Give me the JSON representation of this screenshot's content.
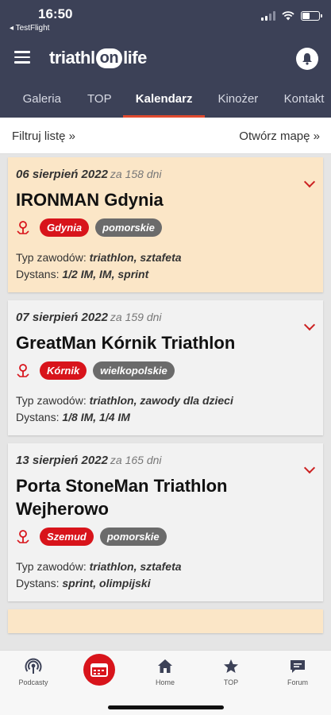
{
  "status": {
    "time": "16:50",
    "back_label": "◂ TestFlight"
  },
  "header": {
    "logo_left": "triathl",
    "logo_on": "on",
    "logo_right": "life"
  },
  "tabs": [
    {
      "label": "Galeria"
    },
    {
      "label": "TOP"
    },
    {
      "label": "Kalendarz"
    },
    {
      "label": "Kinożer"
    },
    {
      "label": "Kontakt"
    }
  ],
  "filter": {
    "left": "Filtruj listę »",
    "right": "Otwórz mapę »"
  },
  "events": [
    {
      "date": "06 sierpień 2022",
      "when": "za 158 dni",
      "title": "IRONMAN Gdynia",
      "city": "Gdynia",
      "region": "pomorskie",
      "type_label": "Typ zawodów:",
      "type_value": "triathlon, sztafeta",
      "dist_label": "Dystans:",
      "dist_value": "1/2 IM, IM, sprint"
    },
    {
      "date": "07 sierpień 2022",
      "when": "za 159 dni",
      "title": "GreatMan Kórnik Triathlon",
      "city": "Kórnik",
      "region": "wielkopolskie",
      "type_label": "Typ zawodów:",
      "type_value": "triathlon, zawody dla dzieci",
      "dist_label": "Dystans:",
      "dist_value": "1/8 IM, 1/4 IM"
    },
    {
      "date": "13 sierpień 2022",
      "when": "za 165 dni",
      "title": "Porta StoneMan Triathlon Wejherowo",
      "city": "Szemud",
      "region": "pomorskie",
      "type_label": "Typ zawodów:",
      "type_value": "triathlon, sztafeta",
      "dist_label": "Dystans:",
      "dist_value": "sprint, olimpijski"
    }
  ],
  "bottom_nav": [
    {
      "label": "Podcasty",
      "icon": "podcast-icon"
    },
    {
      "label": "",
      "icon": "calendar-icon"
    },
    {
      "label": "Home",
      "icon": "home-icon"
    },
    {
      "label": "TOP",
      "icon": "star-icon"
    },
    {
      "label": "Forum",
      "icon": "forum-icon"
    }
  ],
  "colors": {
    "header": "#3c4157",
    "accent": "#d8141b",
    "tab_underline": "#e04a2f",
    "highlight": "#fbe6c7"
  }
}
